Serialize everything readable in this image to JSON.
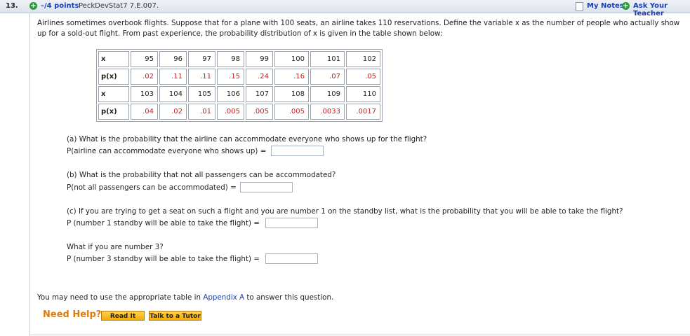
{
  "header": {
    "question_number": "13.",
    "points": "–/4 points",
    "problem_id": "PeckDevStat7 7.E.007.",
    "my_notes": "My Notes",
    "ask_teacher": "Ask Your Teacher"
  },
  "intro": "Airlines sometimes overbook flights. Suppose that for a plane with 100 seats, an airline takes 110 reservations. Define the variable x as the number of people who actually show up for a sold-out flight. From past experience, the probability distribution of x is given in the table shown below:",
  "table": {
    "x_label": "x",
    "px_label": "p(x)",
    "row1_x": [
      "95",
      "96",
      "97",
      "98",
      "99",
      "100",
      "101",
      "102"
    ],
    "row1_p": [
      ".02",
      ".11",
      ".11",
      ".15",
      ".24",
      ".16",
      ".07",
      ".05"
    ],
    "row2_x": [
      "103",
      "104",
      "105",
      "106",
      "107",
      "108",
      "109",
      "110"
    ],
    "row2_p": [
      ".04",
      ".02",
      ".01",
      ".005",
      ".005",
      ".005",
      ".0033",
      ".0017"
    ]
  },
  "parts": {
    "a_question": "(a) What is the probability that the airline can accommodate everyone who shows up for the flight?",
    "a_label": "P(airline can accommodate everyone who shows up) =",
    "a_value": "",
    "b_question": "(b) What is the probability that not all passengers can be accommodated?",
    "b_label": "P(not all passengers can be accommodated) =",
    "b_value": "",
    "c_question": "(c) If you are trying to get a seat on such a flight and you are number 1 on the standby list, what is the probability that you will be able to take the flight?",
    "c_label": "P (number 1 standby will be able to take the flight) =",
    "c_value": "",
    "d_question": "What if you are number 3?",
    "d_label": "P (number 3 standby will be able to take the flight) =",
    "d_value": ""
  },
  "footer": {
    "note_prefix": "You may need to use the appropriate table in ",
    "note_link": "Appendix A",
    "note_suffix": " to answer this question.",
    "need_help": "Need Help?",
    "read_it": "Read It",
    "talk_tutor": "Talk to a Tutor"
  },
  "colors": {
    "link": "#1a3fb0",
    "table_probability": "#d8141b",
    "need_help": "#e07b0b",
    "button": "#f2a90f"
  }
}
